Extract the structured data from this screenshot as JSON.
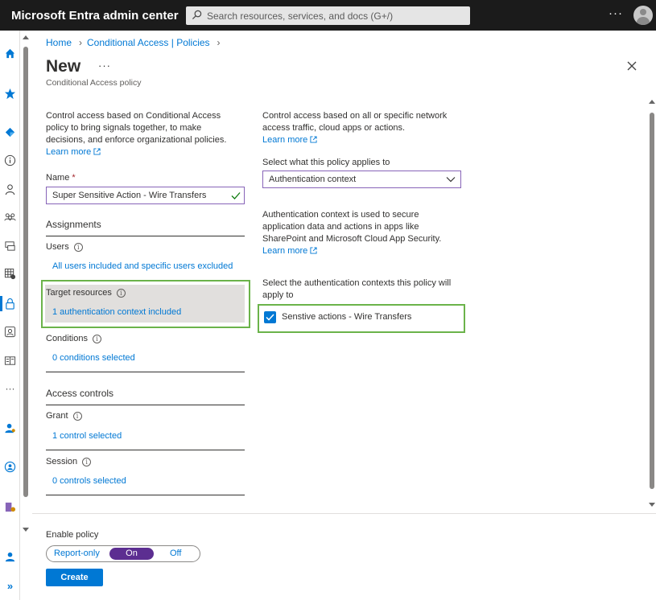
{
  "topbar": {
    "app_title": "Microsoft Entra admin center",
    "search_placeholder": "Search resources, services, and docs (G+/)",
    "more_label": "···"
  },
  "breadcrumb": {
    "items": [
      "Home",
      "Conditional Access | Policies"
    ]
  },
  "header": {
    "title": "New",
    "more_label": "···",
    "subtitle": "Conditional Access policy"
  },
  "left_column": {
    "intro": [
      "Control access based on Conditional Access",
      "policy to bring signals together, to make",
      "decisions, and enforce organizational policies."
    ],
    "learn_more": "Learn more",
    "name_label": "Name",
    "required_mark": "*",
    "name_value": "Super Sensitive Action - Wire Transfers",
    "assignments_heading": "Assignments",
    "users_label": "Users",
    "users_value": "All users included and specific users excluded",
    "target_label": "Target resources",
    "target_value": "1 authentication context included",
    "conditions_label": "Conditions",
    "conditions_value": "0 conditions selected",
    "access_controls_heading": "Access controls",
    "grant_label": "Grant",
    "grant_value": "1 control selected",
    "session_label": "Session",
    "session_value": "0 controls selected"
  },
  "right_column": {
    "intro": [
      "Control access based on all or specific network",
      "access traffic, cloud apps or actions."
    ],
    "learn_more": "Learn more",
    "applies_label": "Select what this policy applies to",
    "applies_value": "Authentication context",
    "desc": [
      "Authentication context is used to secure",
      "application data and actions in apps like",
      "SharePoint and Microsoft Cloud App Security."
    ],
    "learn_more_2": "Learn more",
    "select_contexts": [
      "Select the authentication contexts this policy will",
      "apply to"
    ],
    "context_option": "Senstive actions - Wire Transfers",
    "context_checked": true
  },
  "footer": {
    "enable_label": "Enable policy",
    "toggle": [
      "Report-only",
      "On",
      "Off"
    ],
    "toggle_selected": "On",
    "create_label": "Create"
  },
  "colors": {
    "accent": "#0078d4",
    "highlight_border": "#6bb34a",
    "toggle_on": "#5c2e91",
    "topbar": "#1b1b1b"
  }
}
